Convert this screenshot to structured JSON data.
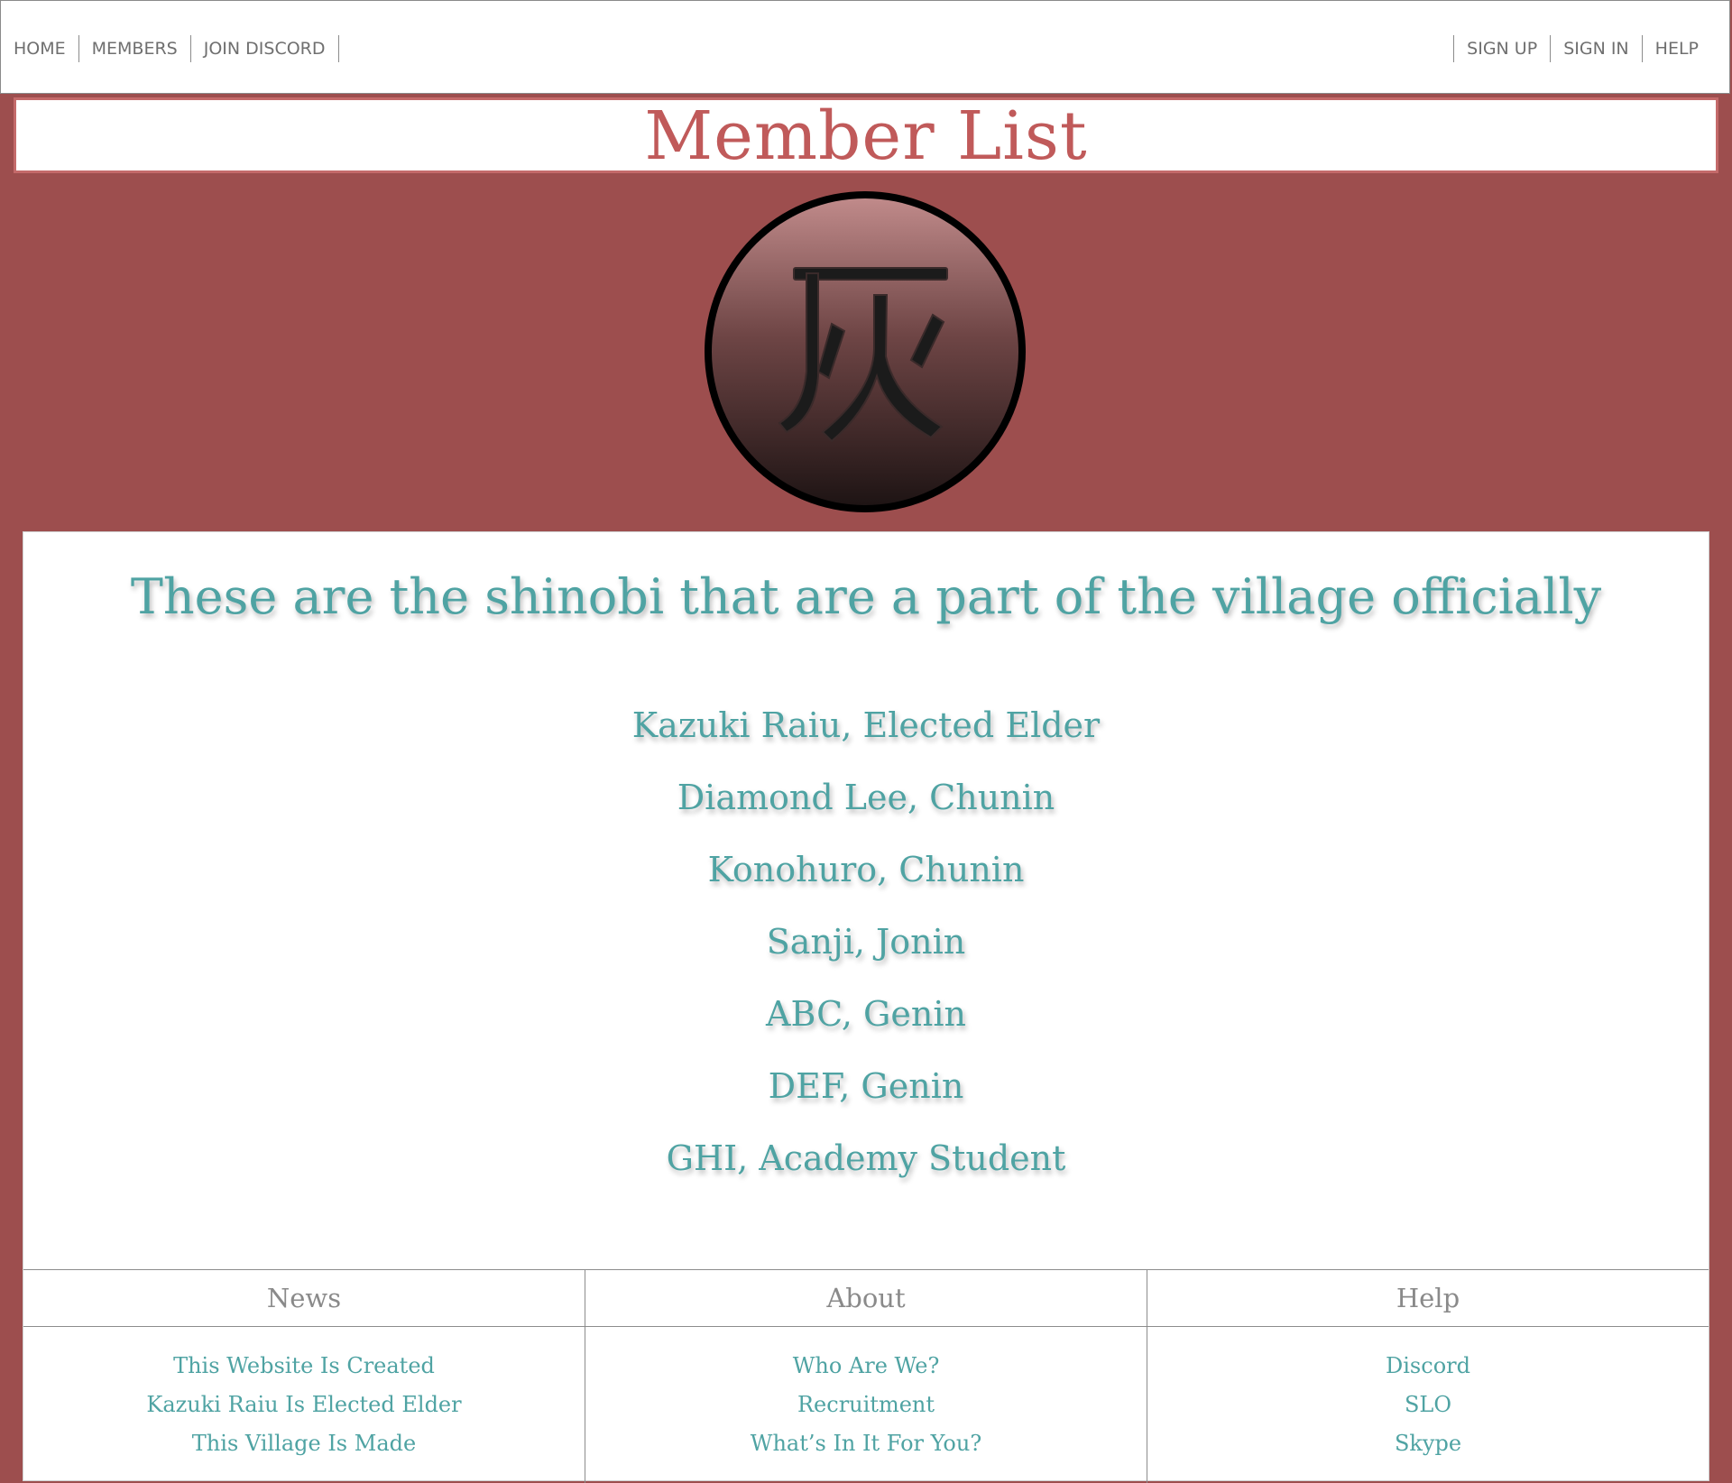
{
  "nav": {
    "left": [
      "HOME",
      "MEMBERS",
      "JOIN DISCORD"
    ],
    "right": [
      "SIGN UP",
      "SIGN IN",
      "HELP"
    ]
  },
  "page_title": "Member List",
  "emblem": {
    "glyph": "灰",
    "icon": "village-emblem-icon"
  },
  "content": {
    "headline": "These are the shinobi that are a part of the village officially",
    "members": [
      "Kazuki Raiu, Elected Elder",
      "Diamond Lee, Chunin",
      "Konohuro, Chunin",
      "Sanji, Jonin",
      "ABC, Genin",
      "DEF, Genin",
      "GHI, Academy Student"
    ]
  },
  "footer": {
    "news": {
      "title": "News",
      "links": [
        "This Website Is Created",
        "Kazuki Raiu Is Elected Elder",
        "This Village Is Made"
      ]
    },
    "about": {
      "title": "About",
      "links": [
        "Who Are We?",
        "Recruitment",
        "What’s In It For You?"
      ]
    },
    "help": {
      "title": "Help",
      "links": [
        "Discord",
        "SLO",
        "Skype"
      ]
    }
  },
  "colors": {
    "background": "#9d4e4e",
    "title": "#c05a5a",
    "teal_text": "#4fa3a3",
    "nav_text": "#6f6f6f"
  }
}
